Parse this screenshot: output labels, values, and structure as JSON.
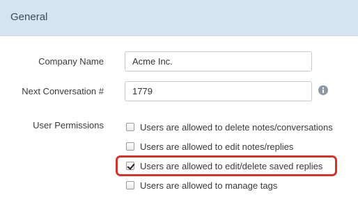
{
  "section": {
    "title": "General"
  },
  "fields": {
    "company_name": {
      "label": "Company Name",
      "value": "Acme Inc."
    },
    "next_conversation": {
      "label": "Next Conversation #",
      "value": "1779",
      "info_icon": "info-icon"
    }
  },
  "permissions": {
    "label": "User Permissions",
    "items": [
      {
        "label": "Users are allowed to delete notes/conversations",
        "checked": false
      },
      {
        "label": "Users are allowed to edit notes/replies",
        "checked": false
      },
      {
        "label": "Users are allowed to edit/delete saved replies",
        "checked": true
      },
      {
        "label": "Users are allowed to manage tags",
        "checked": false
      }
    ]
  },
  "colors": {
    "header_bg": "#d6e4f2",
    "highlight": "#d0352b"
  }
}
